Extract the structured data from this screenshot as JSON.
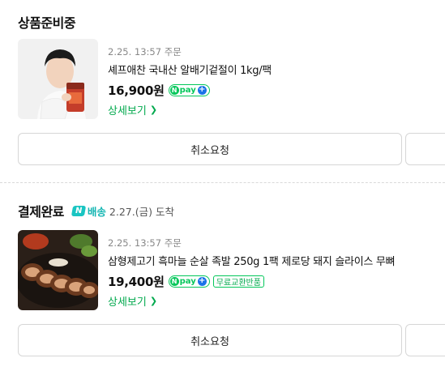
{
  "sections": [
    {
      "title": "상품준비중",
      "product": {
        "order_date": "2.25. 13:57 주문",
        "name": "셰프애찬 국내산 알배기겉절이 1kg/팩",
        "price": "16,900원",
        "pay_badge": "pay",
        "detail_link": "상세보기"
      },
      "cancel_button": "취소요청"
    },
    {
      "title": "결제완료",
      "delivery": {
        "badge": "N",
        "label": "배송",
        "text": "2.27.(금) 도착"
      },
      "product": {
        "order_date": "2.25. 13:57 주문",
        "name": "삼형제고기 흑마늘 순살 족발 250g 1팩 제로당 돼지 슬라이스 무뼈",
        "price": "19,400원",
        "pay_badge": "pay",
        "extra_badge": "무료교환반품",
        "detail_link": "상세보기"
      },
      "cancel_button": "취소요청"
    }
  ],
  "colors": {
    "accent_green": "#03c75a",
    "link_green": "#03a94e",
    "delivery_teal": "#12b5b2"
  },
  "icons": {
    "npay": "npay-badge-icon",
    "chevron": "chevron-right-icon",
    "delivery": "naver-delivery-icon"
  }
}
